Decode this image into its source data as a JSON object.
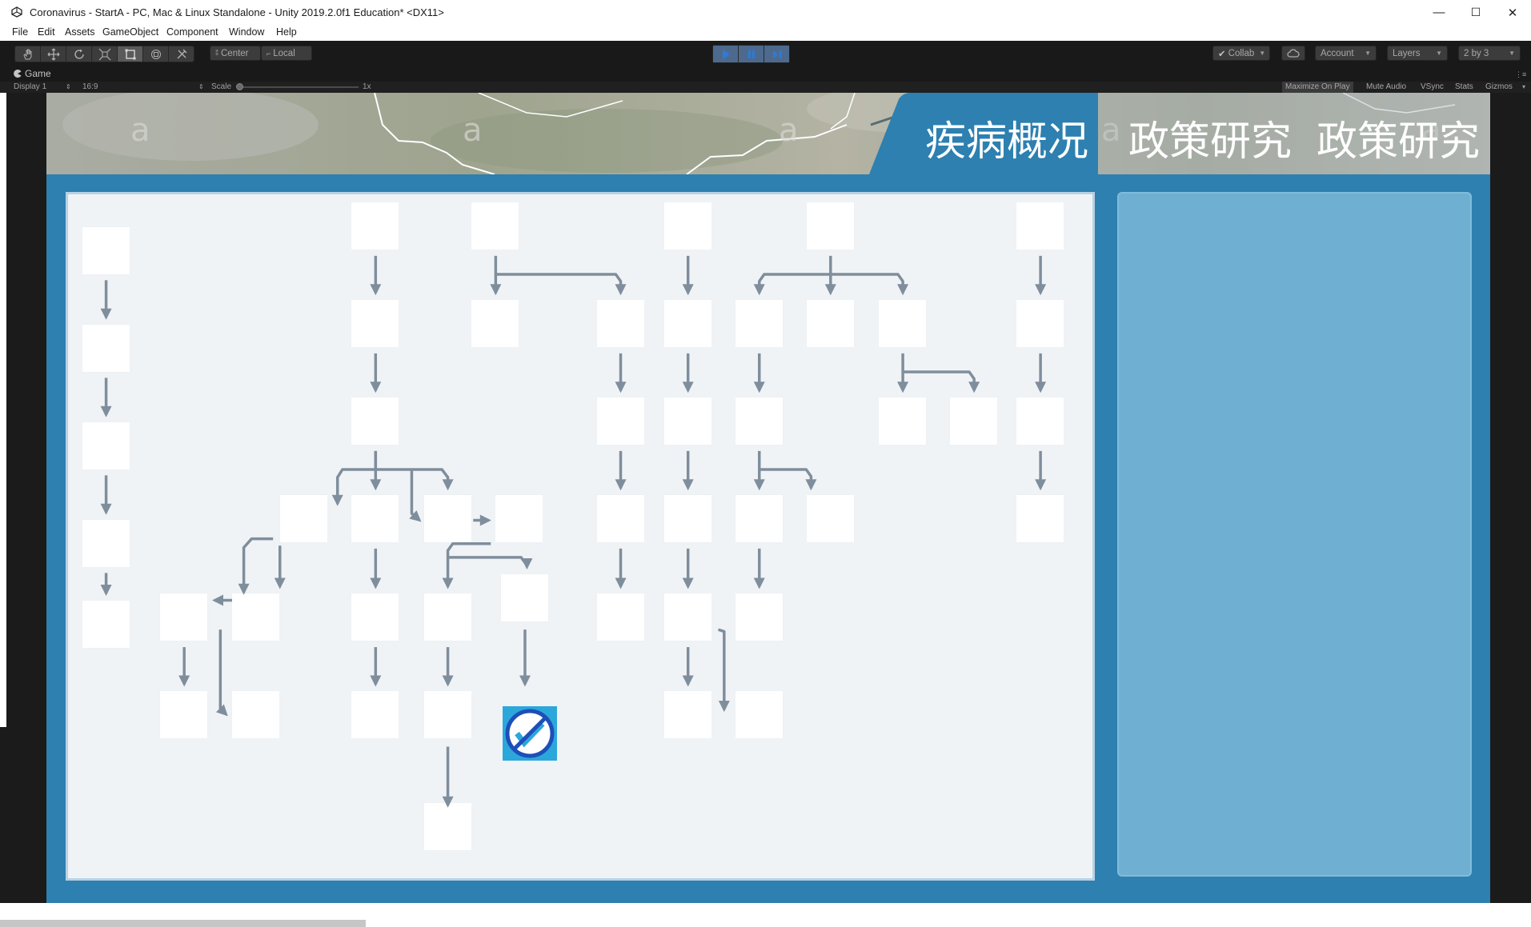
{
  "window": {
    "title": "Coronavirus - StartA - PC, Mac & Linux Standalone - Unity 2019.2.0f1 Education* <DX11>",
    "controls": {
      "minimize": "—",
      "maximize": "☐",
      "close": "✕"
    }
  },
  "menu": [
    "File",
    "Edit",
    "Assets",
    "GameObject",
    "Component",
    "Window",
    "Help"
  ],
  "toolbar": {
    "tools": [
      "hand-tool",
      "move-tool",
      "rotate-tool",
      "scale-tool",
      "rect-tool",
      "transform-tool",
      "custom-tool"
    ],
    "pivot_label": "Center",
    "space_label": "Local",
    "collab_label": "Collab",
    "account_label": "Account",
    "layers_label": "Layers",
    "layout_label": "2 by 3"
  },
  "game_view": {
    "tab_label": "Game",
    "display_label": "Display 1",
    "aspect_label": "16:9",
    "scale_label": "Scale",
    "scale_value": "1x",
    "buttons": [
      "Maximize On Play",
      "Mute Audio",
      "VSync",
      "Stats",
      "Gizmos"
    ]
  },
  "game": {
    "tabs": [
      "疾病概况",
      "政策研究",
      "政策研究"
    ],
    "active_tab": 0,
    "map_watermark": "a",
    "accent_color": "#2d80b0",
    "panel_color": "#f0f3f6",
    "node_color": "#ffffff",
    "arrow_color": "#7f8e9c",
    "badge_icon": "vaccine-blocked-icon"
  }
}
